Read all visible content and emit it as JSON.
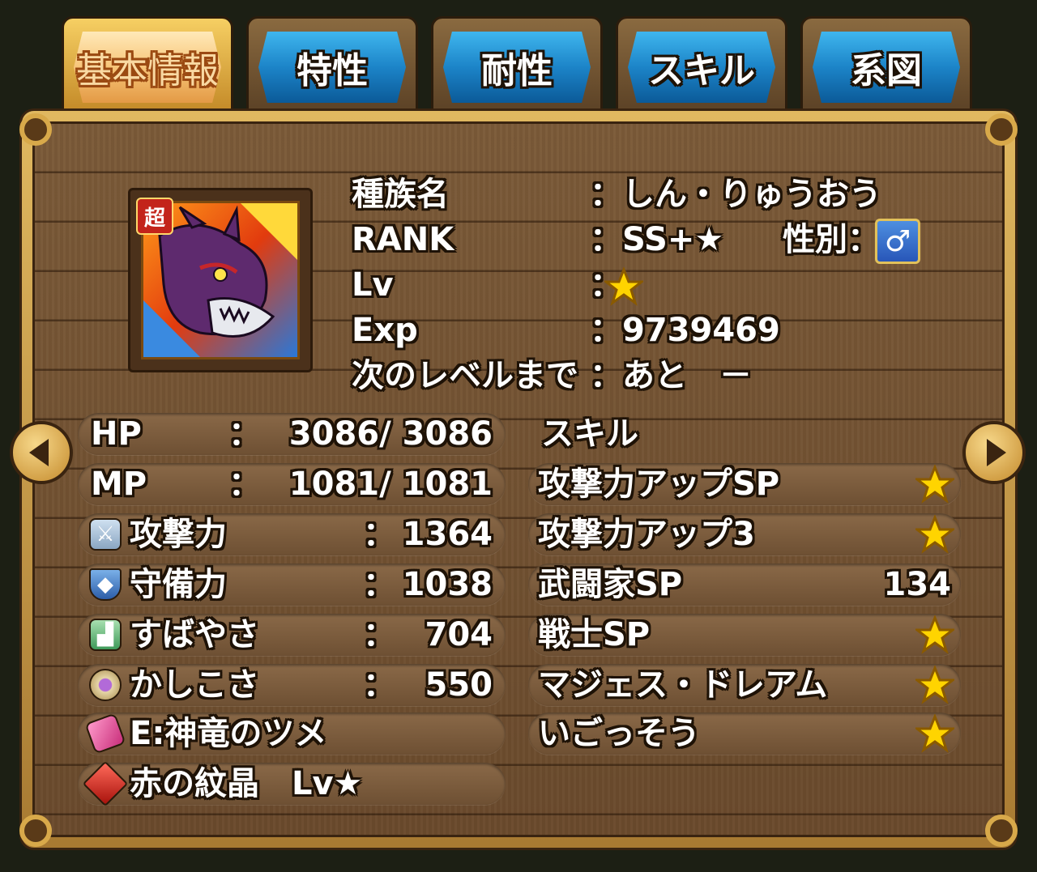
{
  "tabs": [
    {
      "label": "基本情報",
      "active": true
    },
    {
      "label": "特性",
      "active": false
    },
    {
      "label": "耐性",
      "active": false
    },
    {
      "label": "スキル",
      "active": false
    },
    {
      "label": "系図",
      "active": false
    }
  ],
  "portrait": {
    "badge": "超",
    "icon": "dragon-portrait-icon"
  },
  "info": {
    "name_label": "種族名",
    "name_value": "：しん・りゅうおう",
    "rank_label": "RANK",
    "rank_value": "：SS+★",
    "gender_label": "性別：",
    "gender_value": "♂",
    "lv_label": "Lv",
    "lv_value": "：",
    "exp_label": "Exp",
    "exp_value": "：9739469",
    "next_label": "次のレベルまで",
    "next_value": "：あと　－"
  },
  "stats": {
    "hp_label": "HP",
    "hp_colon": "：",
    "hp_value": "3086/ 3086",
    "mp_label": "MP",
    "mp_colon": "：",
    "mp_value": "1081/ 1081",
    "atk_label": "攻撃力",
    "atk_colon": "：",
    "atk_value": "1364",
    "def_label": "守備力",
    "def_colon": "：",
    "def_value": "1038",
    "spd_label": "すばやさ",
    "spd_colon": "：",
    "spd_value": "704",
    "int_label": "かしこさ",
    "int_colon": "：",
    "int_value": "550",
    "equip_label": "E:神竜のツメ",
    "crest_label": "赤の紋晶　Lv★"
  },
  "skills": {
    "header": "スキル",
    "items": [
      {
        "name": "攻撃力アップSP",
        "value": ""
      },
      {
        "name": "攻撃力アップ3",
        "value": ""
      },
      {
        "name": "武闘家SP",
        "value": "134"
      },
      {
        "name": "戦士SP",
        "value": ""
      },
      {
        "name": "マジェス・ドレアム",
        "value": ""
      },
      {
        "name": "いごっそう",
        "value": ""
      }
    ]
  },
  "colors": {
    "tab_blue": "#1c84c8",
    "tab_active": "#f7c579",
    "star": "#ffd400",
    "wood": "#6a4a2c"
  }
}
